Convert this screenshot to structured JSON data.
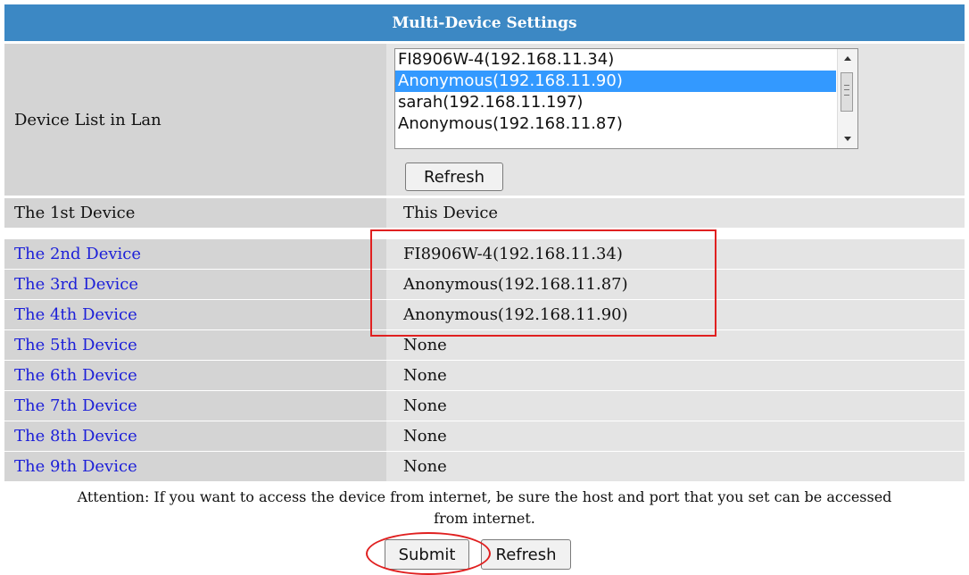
{
  "header": {
    "title": "Multi-Device Settings"
  },
  "lan": {
    "label": "Device List in Lan",
    "listbox_items": [
      "FI8906W-4(192.168.11.34)",
      "Anonymous(192.168.11.90)",
      "sarah(192.168.11.197)",
      "Anonymous(192.168.11.87)"
    ],
    "selected_item": "Anonymous(192.168.11.90)",
    "refresh_label": "Refresh"
  },
  "devices": [
    {
      "label": "The 1st Device",
      "value": "This Device"
    },
    {
      "label": "The 2nd Device",
      "value": "FI8906W-4(192.168.11.34)"
    },
    {
      "label": "The 3rd Device",
      "value": "Anonymous(192.168.11.87)"
    },
    {
      "label": "The 4th Device",
      "value": "Anonymous(192.168.11.90)"
    },
    {
      "label": "The 5th Device",
      "value": "None"
    },
    {
      "label": "The 6th Device",
      "value": "None"
    },
    {
      "label": "The 7th Device",
      "value": "None"
    },
    {
      "label": "The 8th Device",
      "value": "None"
    },
    {
      "label": "The 9th Device",
      "value": "None"
    }
  ],
  "footer": {
    "attention_line1": "Attention: If you want to access the device from internet, be sure the host and port that you set can be accessed",
    "attention_line2": "from internet.",
    "submit_label": "Submit",
    "refresh_label": "Refresh"
  },
  "colors": {
    "header_bg": "#3c88c4",
    "label_cell_bg": "#d4d4d4",
    "value_cell_bg": "#e4e4e4",
    "link_text": "#1d20d8",
    "selection_bg": "#3399ff",
    "annotation_red": "#e02020"
  }
}
